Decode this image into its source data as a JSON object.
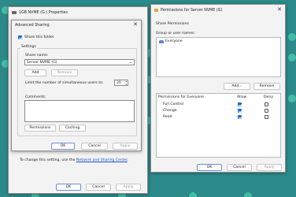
{
  "properties_window": {
    "title": "1GB NVME (G:) Properties",
    "footer_text": "To change this setting, use the",
    "footer_link": "Network and Sharing Center",
    "footer_end": ".",
    "buttons": {
      "ok": "OK",
      "cancel": "Cancel",
      "apply": "Apply"
    }
  },
  "advanced_sharing": {
    "title": "Advanced Sharing",
    "share_checkbox_label": "Share this folder",
    "share_checked": true,
    "settings_label": "Settings",
    "share_name_label": "Share name:",
    "share_name_value": "Server NVME (G)",
    "add_button": "Add",
    "remove_button": "Remove",
    "limit_label": "Limit the number of simultaneous users to:",
    "limit_value": "20",
    "comments_label": "Comments:",
    "permissions_button": "Permissions",
    "caching_button": "Caching",
    "buttons": {
      "ok": "OK",
      "cancel": "Cancel",
      "apply": "Apply"
    }
  },
  "permissions_window": {
    "title": "Permissions for Server NVME (G)",
    "tab_label": "Share Permissions",
    "group_label": "Group or user names:",
    "users": [
      {
        "name": "Everyone",
        "icon": "users-icon"
      }
    ],
    "add_button": "Add...",
    "remove_button": "Remove",
    "perm_header": "Permissions for Everyone",
    "allow_header": "Allow",
    "deny_header": "Deny",
    "permissions": [
      {
        "name": "Full Control",
        "allow": true,
        "deny": false
      },
      {
        "name": "Change",
        "allow": true,
        "deny": false
      },
      {
        "name": "Read",
        "allow": true,
        "deny": false
      }
    ],
    "buttons": {
      "ok": "OK",
      "cancel": "Cancel",
      "apply": "Apply"
    }
  }
}
